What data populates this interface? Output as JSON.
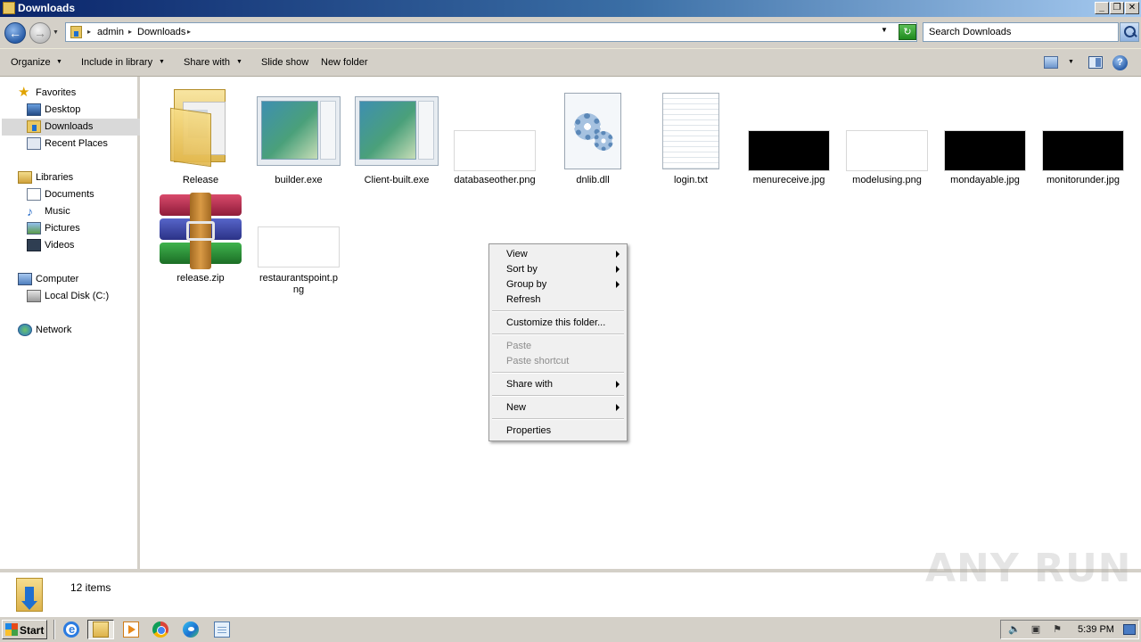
{
  "window": {
    "title": "Downloads",
    "controls": {
      "minimize": "_",
      "restore": "❐",
      "close": "✕"
    }
  },
  "address": {
    "breadcrumbs": [
      "admin",
      "Downloads"
    ],
    "search_placeholder": "Search Downloads"
  },
  "toolbar": {
    "organize": "Organize",
    "include_in_library": "Include in library",
    "share_with": "Share with",
    "slide_show": "Slide show",
    "new_folder": "New folder",
    "help": "?"
  },
  "sidebar": {
    "favorites": {
      "label": "Favorites",
      "items": [
        {
          "label": "Desktop",
          "icon": "desktop-icon"
        },
        {
          "label": "Downloads",
          "icon": "downloads-folder-icon",
          "selected": true
        },
        {
          "label": "Recent Places",
          "icon": "recent-places-icon"
        }
      ]
    },
    "libraries": {
      "label": "Libraries",
      "items": [
        {
          "label": "Documents",
          "icon": "documents-icon"
        },
        {
          "label": "Music",
          "icon": "music-icon"
        },
        {
          "label": "Pictures",
          "icon": "pictures-icon"
        },
        {
          "label": "Videos",
          "icon": "videos-icon"
        }
      ]
    },
    "computer": {
      "label": "Computer",
      "items": [
        {
          "label": "Local Disk (C:)",
          "icon": "disk-icon"
        }
      ]
    },
    "network": {
      "label": "Network"
    }
  },
  "files": [
    {
      "name": "Release",
      "type": "folder"
    },
    {
      "name": "builder.exe",
      "type": "exe"
    },
    {
      "name": "Client-built.exe",
      "type": "exe"
    },
    {
      "name": "databaseother.png",
      "type": "image-light"
    },
    {
      "name": "dnlib.dll",
      "type": "dll"
    },
    {
      "name": "login.txt",
      "type": "txt"
    },
    {
      "name": "menureceive.jpg",
      "type": "image-dark"
    },
    {
      "name": "modelusing.png",
      "type": "image-light"
    },
    {
      "name": "mondayable.jpg",
      "type": "image-dark"
    },
    {
      "name": "monitorunder.jpg",
      "type": "image-dark"
    },
    {
      "name": "release.zip",
      "type": "zip"
    },
    {
      "name": "restaurantspoint.png",
      "type": "image-light"
    }
  ],
  "context_menu": {
    "items": [
      {
        "label": "View",
        "submenu": true
      },
      {
        "label": "Sort by",
        "submenu": true
      },
      {
        "label": "Group by",
        "submenu": true
      },
      {
        "label": "Refresh"
      },
      {
        "label": "Customize this folder..."
      },
      {
        "label": "Paste",
        "disabled": true
      },
      {
        "label": "Paste shortcut",
        "disabled": true
      },
      {
        "label": "Share with",
        "submenu": true
      },
      {
        "label": "New",
        "submenu": true
      },
      {
        "label": "Properties"
      }
    ]
  },
  "details": {
    "item_count": "12 items"
  },
  "watermark": "ANY RUN",
  "taskbar": {
    "start_label": "Start",
    "clock": "5:39 PM"
  }
}
